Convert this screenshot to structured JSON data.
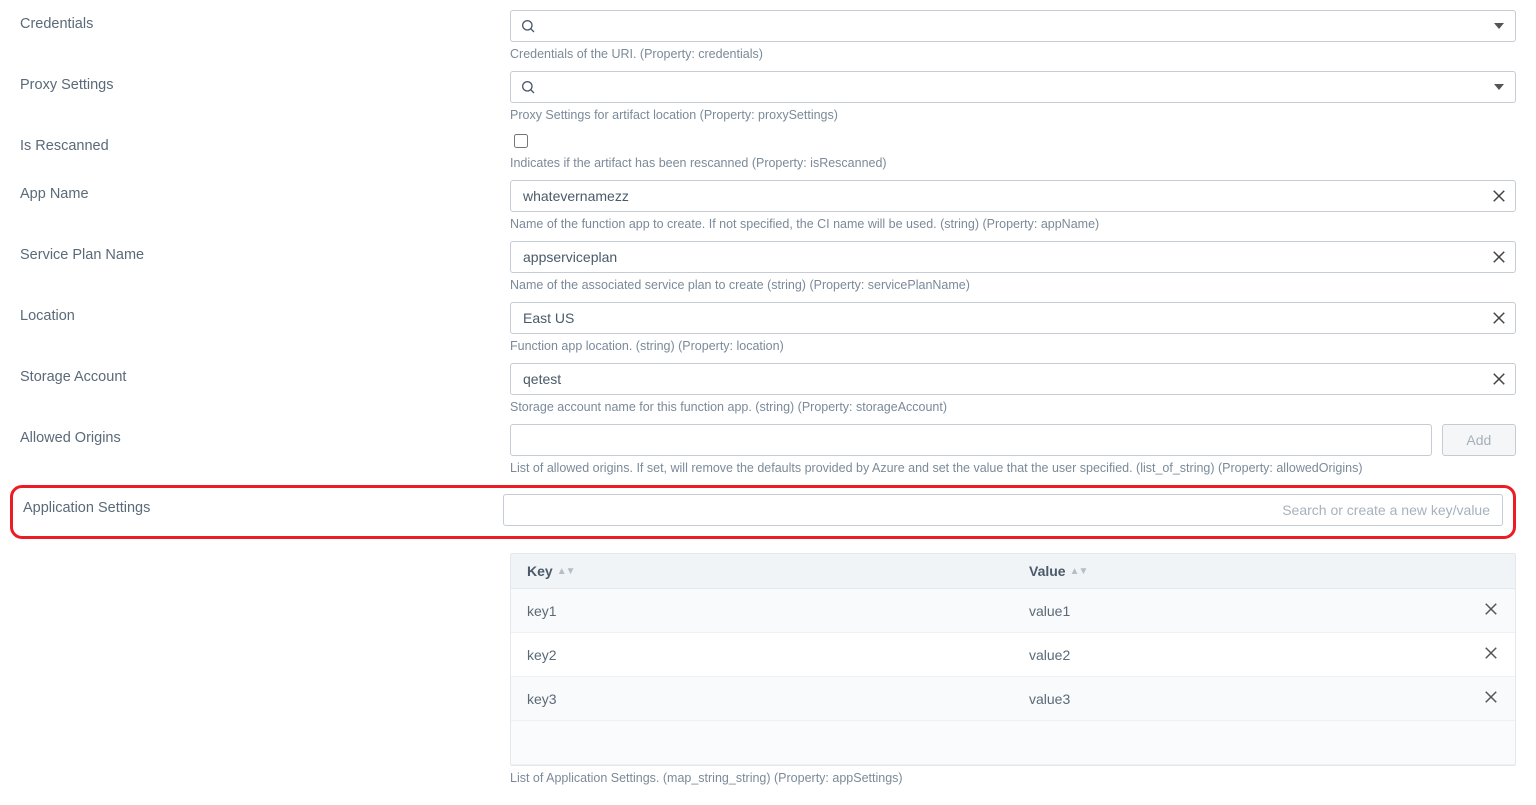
{
  "fields": {
    "credentials": {
      "label": "Credentials",
      "help": "Credentials of the URI. (Property: credentials)"
    },
    "proxySettings": {
      "label": "Proxy Settings",
      "help": "Proxy Settings for artifact location (Property: proxySettings)"
    },
    "isRescanned": {
      "label": "Is Rescanned",
      "help": "Indicates if the artifact has been rescanned (Property: isRescanned)"
    },
    "appName": {
      "label": "App Name",
      "value": "whatevernamezz",
      "help": "Name of the function app to create. If not specified, the CI name will be used. (string) (Property: appName)"
    },
    "servicePlanName": {
      "label": "Service Plan Name",
      "value": "appserviceplan",
      "help": "Name of the associated service plan to create (string) (Property: servicePlanName)"
    },
    "location": {
      "label": "Location",
      "value": "East US",
      "help": "Function app location. (string) (Property: location)"
    },
    "storageAccount": {
      "label": "Storage Account",
      "value": "qetest",
      "help": "Storage account name for this function app. (string) (Property: storageAccount)"
    },
    "allowedOrigins": {
      "label": "Allowed Origins",
      "addLabel": "Add",
      "help": "List of allowed origins. If set, will remove the defaults provided by Azure and set the value that the user specified. (list_of_string) (Property: allowedOrigins)"
    },
    "appSettings": {
      "label": "Application Settings",
      "placeholder": "Search or create a new key/value",
      "columns": {
        "key": "Key",
        "value": "Value"
      },
      "rows": [
        {
          "key": "key1",
          "value": "value1"
        },
        {
          "key": "key2",
          "value": "value2"
        },
        {
          "key": "key3",
          "value": "value3"
        }
      ],
      "help": "List of Application Settings. (map_string_string) (Property: appSettings)"
    }
  }
}
